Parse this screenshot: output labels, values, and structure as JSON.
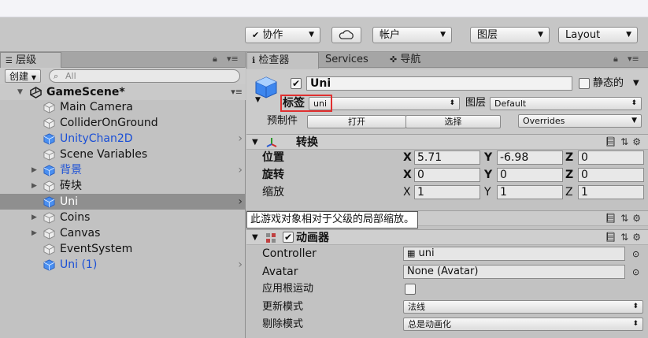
{
  "toolbar": {
    "collab_label": "协作",
    "account_label": "帐户",
    "layers_label": "图层",
    "layout_label": "Layout"
  },
  "hierarchy": {
    "tab_label": "层级",
    "create_label": "创建",
    "search_placeholder": "All",
    "scene_name": "GameScene*",
    "items": [
      {
        "label": "Main Camera"
      },
      {
        "label": "ColliderOnGround"
      },
      {
        "label": "UnityChan2D"
      },
      {
        "label": "Scene Variables"
      },
      {
        "label": "背景"
      },
      {
        "label": "砖块"
      },
      {
        "label": "Uni"
      },
      {
        "label": "Coins"
      },
      {
        "label": "Canvas"
      },
      {
        "label": "EventSystem"
      },
      {
        "label": "Uni (1)"
      }
    ]
  },
  "inspector": {
    "tabs": [
      "检查器",
      "Services",
      "导航"
    ],
    "object_name": "Uni",
    "static_label": "静态的",
    "tag_label": "标签",
    "tag_value": "uni",
    "layer_label": "图层",
    "layer_value": "Default",
    "prefab_label": "预制件",
    "open_label": "打开",
    "select_label": "选择",
    "overrides_label": "Overrides",
    "transform": {
      "title": "转换",
      "position_label": "位置",
      "rotation_label": "旋转",
      "scale_label": "缩放",
      "position": {
        "x": "5.71",
        "y": "-6.98",
        "z": "0"
      },
      "rotation": {
        "x": "0",
        "y": "0",
        "z": "0"
      },
      "scale": {
        "x": "1",
        "y": "1",
        "z": "1"
      },
      "axis_x": "X",
      "axis_y": "Y",
      "axis_z": "Z"
    },
    "tooltip": "此游戏对象相对于父级的局部缩放。",
    "animator": {
      "title": "动画器",
      "controller_label": "Controller",
      "controller_value": "uni",
      "avatar_label": "Avatar",
      "avatar_value": "None (Avatar)",
      "root_motion_label": "应用根运动",
      "update_mode_label": "更新模式",
      "update_mode_value": "法线",
      "culling_mode_label": "剔除模式",
      "culling_mode_value": "总是动画化"
    }
  },
  "colors": {
    "selection": "#8f8f8f",
    "prefab_blue": "#1a4fd6",
    "highlight": "#e03030"
  }
}
